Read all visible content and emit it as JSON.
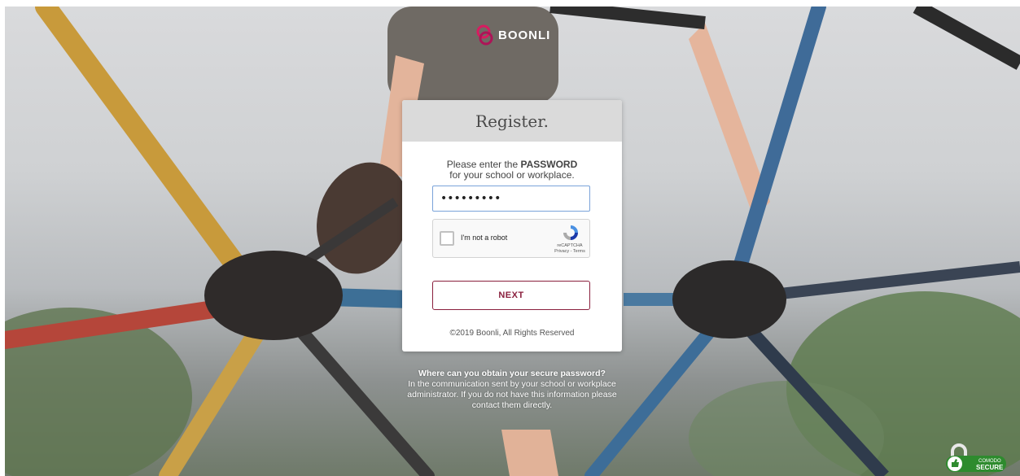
{
  "brand": {
    "name": "BOONLI",
    "accent": "#8a1f3d",
    "logo_color": "#c2185b"
  },
  "card": {
    "title": "Register.",
    "prompt_line1_prefix": "Please enter the ",
    "prompt_line1_strong": "PASSWORD",
    "prompt_line2": "for your school or workplace.",
    "password_value": "•••••••••",
    "captcha": {
      "label": "I'm not a robot",
      "brand": "reCAPTCHA",
      "links": "Privacy - Terms",
      "checked": false,
      "icon": "recaptcha-logo-icon"
    },
    "next_label": "NEXT",
    "copyright": "©2019 Boonli, All Rights Reserved"
  },
  "help": {
    "question": "Where can you obtain your secure password?",
    "answer": "In the communication sent by your school or workplace administrator. If you do not have this information please contact them directly."
  },
  "badge": {
    "icon": "comodo-secure-lock-icon",
    "line1": "COMODO",
    "line2": "SECURE"
  }
}
